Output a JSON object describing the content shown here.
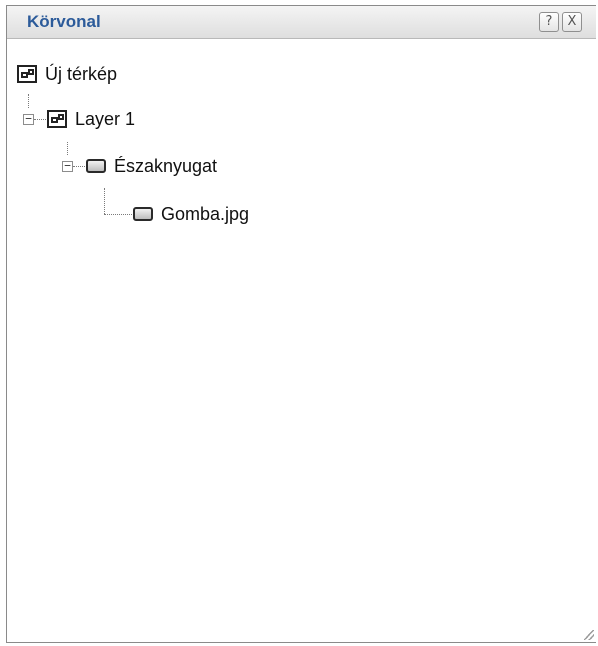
{
  "panel": {
    "title": "Körvonal",
    "help_button": "?",
    "close_button": "X"
  },
  "tree": {
    "root": {
      "label": "Új térkép",
      "icon": "map-icon"
    },
    "layer": {
      "label": "Layer 1",
      "icon": "map-icon",
      "expanded": true,
      "toggle": "−"
    },
    "group": {
      "label": "Északnyugat",
      "icon": "layer-icon",
      "expanded": true,
      "toggle": "−"
    },
    "item": {
      "label": "Gomba.jpg",
      "icon": "layer-icon"
    }
  }
}
